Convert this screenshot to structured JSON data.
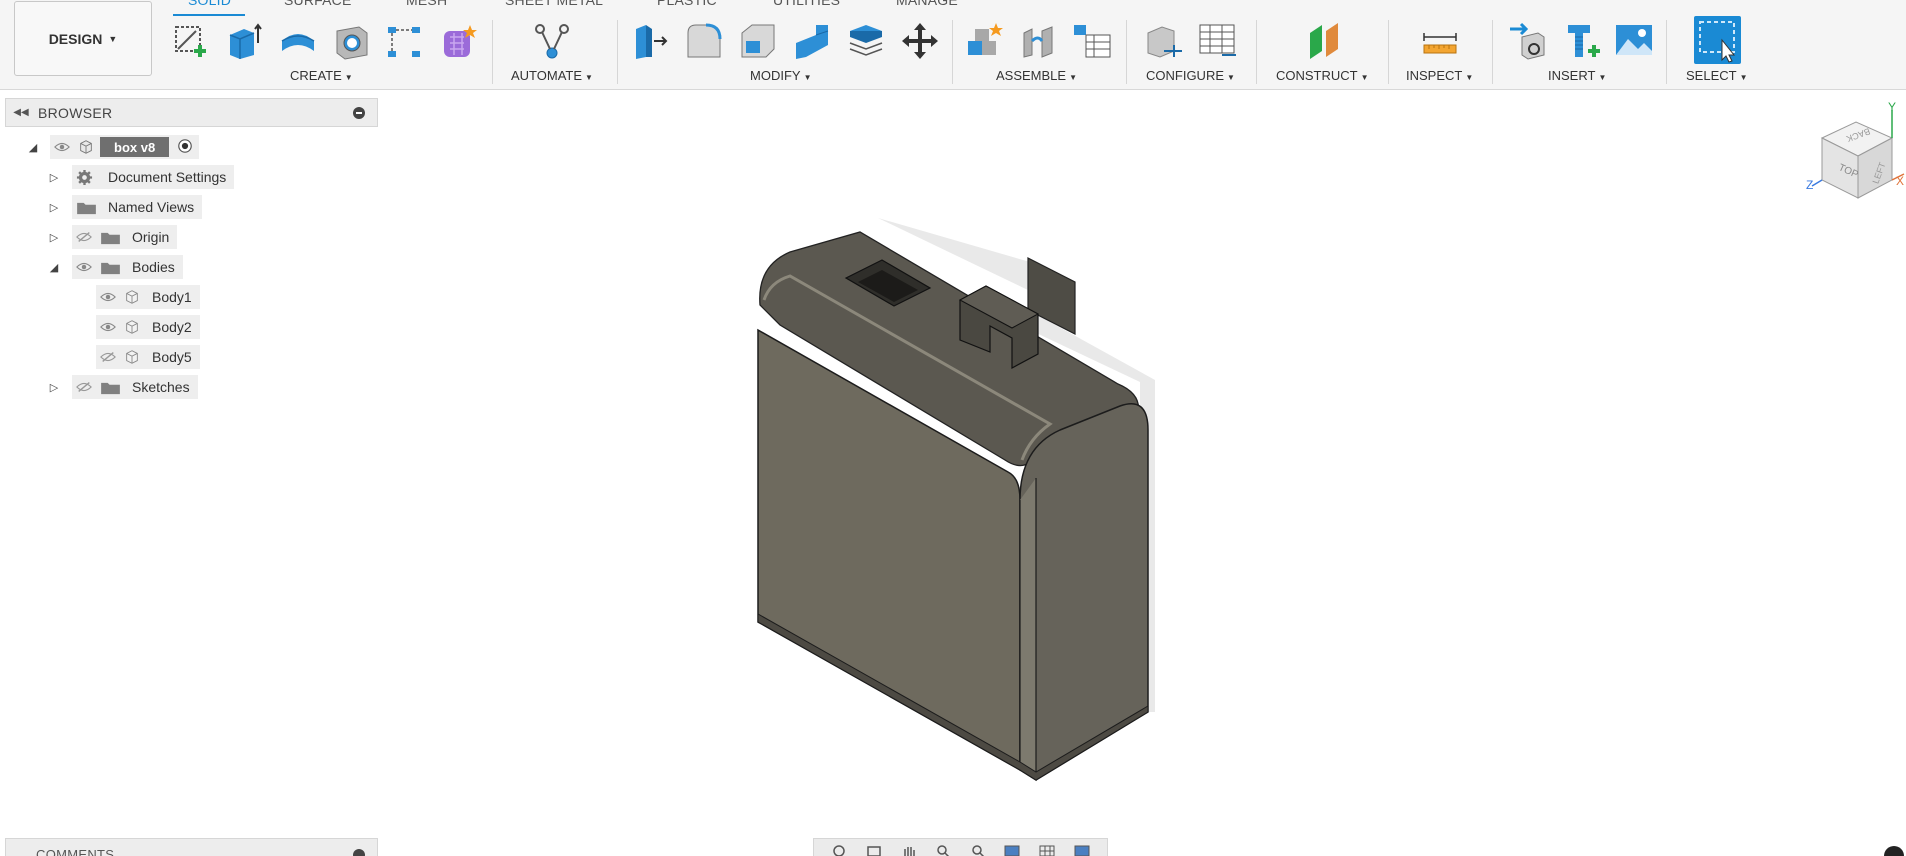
{
  "toolbar": {
    "workspace_label": "DESIGN",
    "tabs": [
      "SOLID",
      "SURFACE",
      "MESH",
      "SHEET METAL",
      "PLASTIC",
      "UTILITIES",
      "MANAGE"
    ],
    "groups": [
      "CREATE",
      "AUTOMATE",
      "MODIFY",
      "ASSEMBLE",
      "CONFIGURE",
      "CONSTRUCT",
      "INSPECT",
      "INSERT",
      "SELECT"
    ]
  },
  "browser": {
    "title": "BROWSER",
    "root": {
      "label": "box v8"
    },
    "items": [
      {
        "label": "Document Settings"
      },
      {
        "label": "Named Views"
      },
      {
        "label": "Origin"
      },
      {
        "label": "Bodies"
      },
      {
        "label": "Body1"
      },
      {
        "label": "Body2"
      },
      {
        "label": "Body5"
      },
      {
        "label": "Sketches"
      }
    ]
  },
  "comments": {
    "title": "COMMENTS"
  },
  "viewcube": {
    "faces": [
      "TOP",
      "BACK",
      "LEFT"
    ],
    "axes": [
      "Y",
      "Z",
      "X"
    ]
  },
  "colors": {
    "accent": "#1a8ad4",
    "body_face": "#6e6a5e",
    "body_top": "#5d5a50",
    "body_side": "#66635a"
  }
}
